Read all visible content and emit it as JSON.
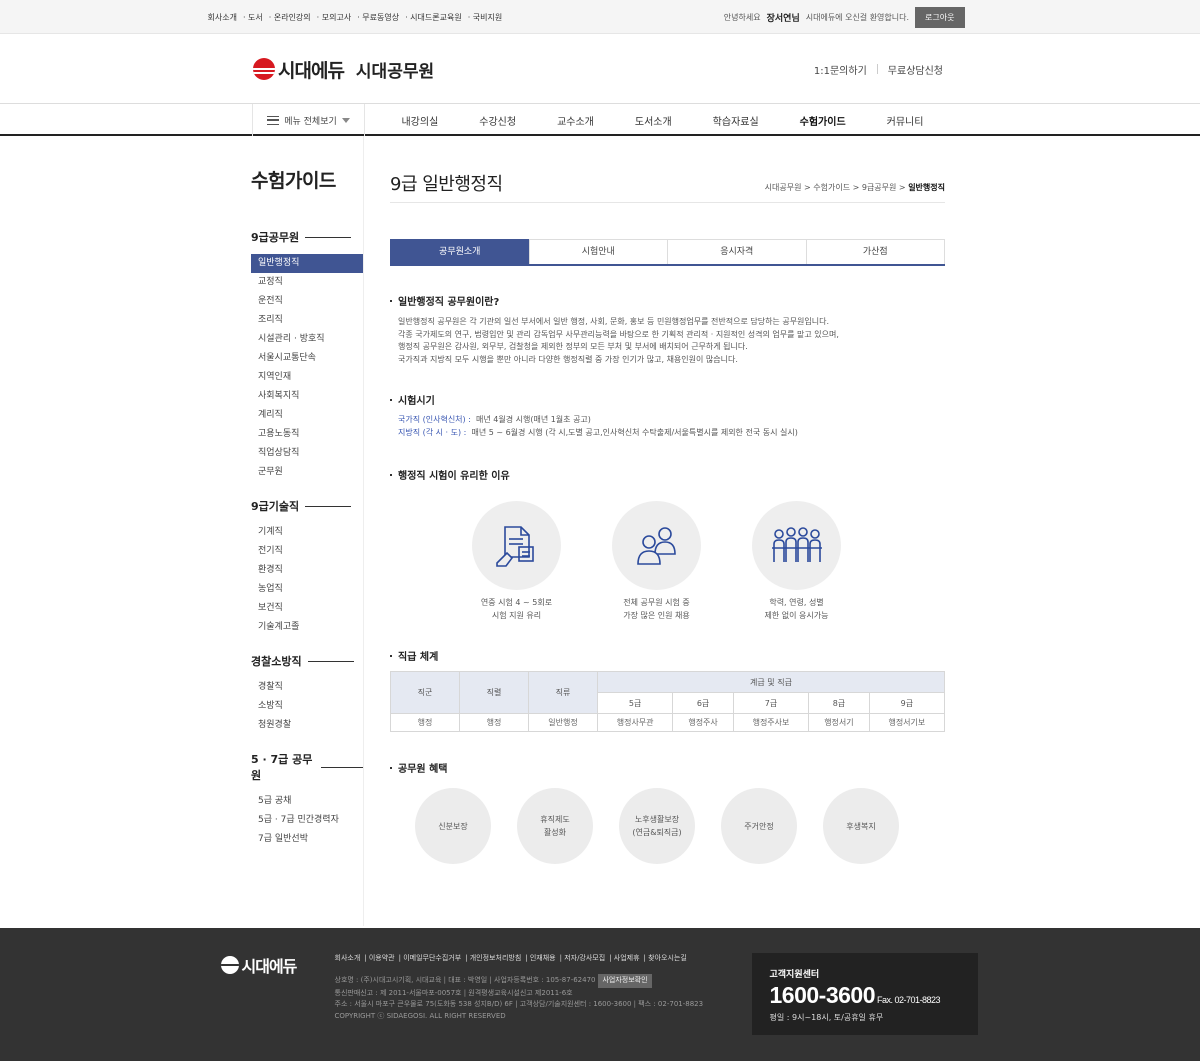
{
  "topbar": {
    "links": [
      "회사소개",
      "· 도서",
      "· 온라인강의",
      "· 모의고사",
      "· 무료동영상",
      "· 시대드론교육원",
      "· 국비지원"
    ],
    "greeting_prefix": "안녕하세요",
    "user_name": "장서연님",
    "greeting_suffix": "시대에듀에 오신걸 환영합니다.",
    "logout": "로그아웃"
  },
  "header": {
    "logo": "시대에듀",
    "site_name": "시대공무원",
    "link_inquiry": "1:1문의하기",
    "link_consult": "무료상담신청"
  },
  "gnb": {
    "all_menu": "메뉴 전체보기",
    "items": [
      "내강의실",
      "수강신청",
      "교수소개",
      "도서소개",
      "학습자료실",
      "수험가이드",
      "커뮤니티"
    ],
    "active_index": 5
  },
  "lnb": {
    "title": "수험가이드",
    "groups": [
      {
        "title": "9급공무원",
        "items": [
          "일반행정직",
          "교정직",
          "운전직",
          "조리직",
          "시설관리 · 방호직",
          "서울시교통단속",
          "지역인재",
          "사회복지직",
          "계리직",
          "고용노동직",
          "직업상담직",
          "군무원"
        ]
      },
      {
        "title": "9급기술직",
        "items": [
          "기계직",
          "전기직",
          "환경직",
          "농업직",
          "보건직",
          "기술계고졸"
        ]
      },
      {
        "title": "경찰소방직",
        "items": [
          "경찰직",
          "소방직",
          "청원경찰"
        ]
      },
      {
        "title": "5 · 7급 공무원",
        "items": [
          "5급 공채",
          "5급 · 7급 민간경력자",
          "7급 일반선박"
        ]
      }
    ]
  },
  "content": {
    "page_title": "9급 일반행정직",
    "breadcrumb": [
      "시대공무원",
      "수험가이드",
      "9급공무원"
    ],
    "breadcrumb_current": "일반행정직",
    "tabs": [
      "공무원소개",
      "시험안내",
      "응시자격",
      "가산점"
    ],
    "sec1_title": "일반행정직 공무원이란?",
    "sec1_lines": [
      "일반행정직 공무원은 각 기관의 일선 부서에서 일반 행정, 사회, 문화, 홍보 등 민원행정업무를 전반적으로 담당하는 공무원입니다.",
      "각종 국가제도의 연구, 법령입안 및 관리 감독업무 사무관리능력을 바탕으로 한 기획적 관리적 · 지원적인 성격의 업무를 맡고 있으며,",
      "행정직 공무원은 감사원, 외무부, 검찰청을 제외한 정부의 모든 부처 및 부서에 배치되어 근무하게 됩니다.",
      "국가직과 지방직 모두 시행을 뿐만 아니라 다양한 행정직렬 중 가장 인기가 많고, 채용인원이 많습니다."
    ],
    "sec2_title": "시험시기",
    "sec2_rows": [
      {
        "label": "국가직 (인사혁신처) :",
        "text": "매년 4월경 시행(매년 1월초 공고)"
      },
      {
        "label": "지방직 (각 시 · 도) :",
        "text": "매년 5 ~ 6월경 시행 (각 시,도별 공고,인사혁신처 수탁출제/서울특별시를 제외한 전국 동시 실시)"
      }
    ],
    "sec3_title": "행정직 시험이 유리한 이유",
    "reasons": [
      {
        "icon": "document-icon",
        "line1": "연중 시험 4 ~ 5회로",
        "line2": "시험 지원 유리"
      },
      {
        "icon": "people-icon",
        "line1": "전체 공무원 시험 중",
        "line2": "가장 많은 인원 채용"
      },
      {
        "icon": "group-icon",
        "line1": "학력, 연령, 성별",
        "line2": "제한 없이 응시가능"
      }
    ],
    "sec4_title": "직급 체계",
    "table": {
      "headers": [
        "직군",
        "직렬",
        "직류"
      ],
      "group_header": "계급 및 직급",
      "grades": [
        "5급",
        "6급",
        "7급",
        "8급",
        "9급"
      ],
      "row": [
        "행정",
        "행정",
        "일반행정",
        "행정사무관",
        "행정주사",
        "행정주사보",
        "행정서기",
        "행정서기보"
      ]
    },
    "sec5_title": "공무원 혜택",
    "benefits": [
      {
        "l1": "신분보장",
        "l2": ""
      },
      {
        "l1": "휴직제도",
        "l2": "활성화"
      },
      {
        "l1": "노후생활보장",
        "l2": "(연금&퇴직금)"
      },
      {
        "l1": "주거안정",
        "l2": ""
      },
      {
        "l1": "후생복지",
        "l2": ""
      }
    ]
  },
  "footer": {
    "logo": "시대에듀",
    "links": [
      "회사소개",
      "| 이용약관",
      "| 이메일무단수집거부",
      "| 개인정보처리방침",
      "| 인재채용",
      "| 저자/강사모집",
      "| 사업제휴",
      "| 찾아오시는길"
    ],
    "info_lines": [
      "상호명 : (주)시대고시기획, 시대교육 | 대표 : 박영일 | 사업자등록번호 : 105-87-62470",
      "통신판매신고 : 제 2011-서울마포-0057호 | 원격평생교육시설신고 제2011-6호",
      "주소 : 서울시 마포구 큰우물로 75(도화동 538 성지B/D) 6F | 고객상담/기술지원센터 : 1600-3600 | 팩스 : 02-701-8823",
      "COPYRIGHT ⓒ SIDAEGOSI. ALL RIGHT RESERVED"
    ],
    "biz_btn": "사업자정보확인",
    "cs_label": "고객지원센터",
    "cs_number": "1600-3600",
    "cs_fax": "Fax. 02-701-8823",
    "cs_hours": "평일 : 9시~18시, 토/공휴일 휴무"
  }
}
